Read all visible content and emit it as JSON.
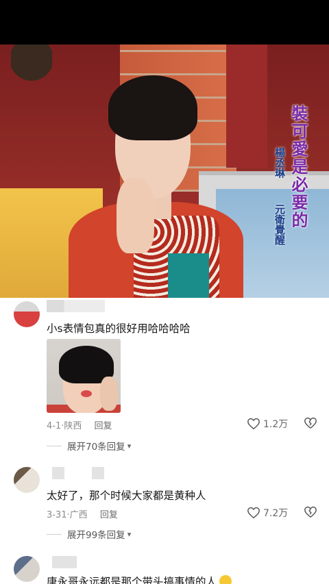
{
  "video": {
    "caption_main": "裝可愛是必要的",
    "caption_name": "楊丞琳",
    "caption_sub": "元衛覺醒"
  },
  "comments": [
    {
      "text": "小s表情包真的很好用哈哈哈哈",
      "date": "4-1",
      "location": "陕西",
      "reply_label": "回复",
      "likes": "1.2万",
      "expand_label": "展开70条回复"
    },
    {
      "text": "太好了，那个时候大家都是黄种人",
      "date": "3-31",
      "location": "广西",
      "reply_label": "回复",
      "likes": "7.2万",
      "expand_label": "展开99条回复"
    },
    {
      "text": "唐永哥永远都是那个带头搞事情的人"
    }
  ],
  "colors": {
    "caption_main": "#7a2aa8",
    "caption_sub": "#1d3f8a",
    "meta_text": "#8a8a8a"
  },
  "icons": {
    "like": "heart-outline-icon",
    "dislike": "broken-heart-icon",
    "expand": "chevron-down-icon"
  }
}
